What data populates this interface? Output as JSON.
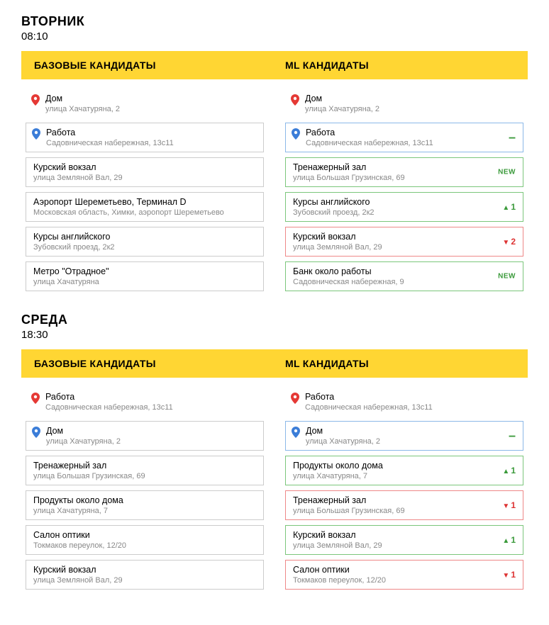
{
  "days": [
    {
      "title": "ВТОРНИК",
      "time": "08:10",
      "base_header": "БАЗОВЫЕ КАНДИДАТЫ",
      "ml_header": "ML КАНДИДАТЫ",
      "base": [
        {
          "name": "Дом",
          "addr": "улица Хачатуряна, 2",
          "pin": "red",
          "noborder": true
        },
        {
          "name": "Работа",
          "addr": "Садовническая набережная, 13с11",
          "pin": "blue"
        },
        {
          "name": "Курский вокзал",
          "addr": "улица Земляной Вал, 29"
        },
        {
          "name": "Аэропорт Шереметьево, Терминал D",
          "addr": "Московская область, Химки, аэропорт Шереметьево"
        },
        {
          "name": "Курсы английского",
          "addr": "Зубовский проезд, 2к2"
        },
        {
          "name": "Метро \"Отрадное\"",
          "addr": "улица Хачатуряна"
        }
      ],
      "ml": [
        {
          "name": "Дом",
          "addr": "улица Хачатуряна, 2",
          "pin": "red",
          "noborder": true
        },
        {
          "name": "Работа",
          "addr": "Садовническая набережная, 13с11",
          "pin": "blue",
          "badge": "dash",
          "badge_text": "–",
          "color": "blue"
        },
        {
          "name": "Тренажерный зал",
          "addr": "улица Большая Грузинская, 69",
          "badge": "new",
          "badge_text": "NEW",
          "color": "green"
        },
        {
          "name": "Курсы английского",
          "addr": "Зубовский проезд, 2к2",
          "badge": "up",
          "badge_text": "1",
          "color": "green"
        },
        {
          "name": "Курский вокзал",
          "addr": "улица Земляной Вал, 29",
          "badge": "down",
          "badge_text": "2",
          "color": "red"
        },
        {
          "name": "Банк около работы",
          "addr": "Садовническая набережная, 9",
          "badge": "new",
          "badge_text": "NEW",
          "color": "green"
        }
      ]
    },
    {
      "title": "СРЕДА",
      "time": "18:30",
      "base_header": "БАЗОВЫЕ КАНДИДАТЫ",
      "ml_header": "ML КАНДИДАТЫ",
      "base": [
        {
          "name": "Работа",
          "addr": "Садовническая набережная, 13с11",
          "pin": "red",
          "noborder": true
        },
        {
          "name": "Дом",
          "addr": "улица Хачатуряна, 2",
          "pin": "blue"
        },
        {
          "name": "Тренажерный зал",
          "addr": "улица Большая Грузинская, 69"
        },
        {
          "name": "Продукты около дома",
          "addr": "улица Хачатуряна, 7"
        },
        {
          "name": "Салон оптики",
          "addr": "Токмаков переулок, 12/20"
        },
        {
          "name": "Курский вокзал",
          "addr": "улица Земляной Вал, 29"
        }
      ],
      "ml": [
        {
          "name": "Работа",
          "addr": "Садовническая набережная, 13с11",
          "pin": "red",
          "noborder": true
        },
        {
          "name": "Дом",
          "addr": "улица Хачатуряна, 2",
          "pin": "blue",
          "badge": "dash",
          "badge_text": "–",
          "color": "blue"
        },
        {
          "name": "Продукты около дома",
          "addr": "улица Хачатуряна, 7",
          "badge": "up",
          "badge_text": "1",
          "color": "green"
        },
        {
          "name": "Тренажерный зал",
          "addr": "улица Большая Грузинская, 69",
          "badge": "down",
          "badge_text": "1",
          "color": "red"
        },
        {
          "name": "Курский вокзал",
          "addr": "улица Земляной Вал, 29",
          "badge": "up",
          "badge_text": "1",
          "color": "green"
        },
        {
          "name": "Салон оптики",
          "addr": "Токмаков переулок, 12/20",
          "badge": "down",
          "badge_text": "1",
          "color": "red"
        }
      ]
    }
  ]
}
